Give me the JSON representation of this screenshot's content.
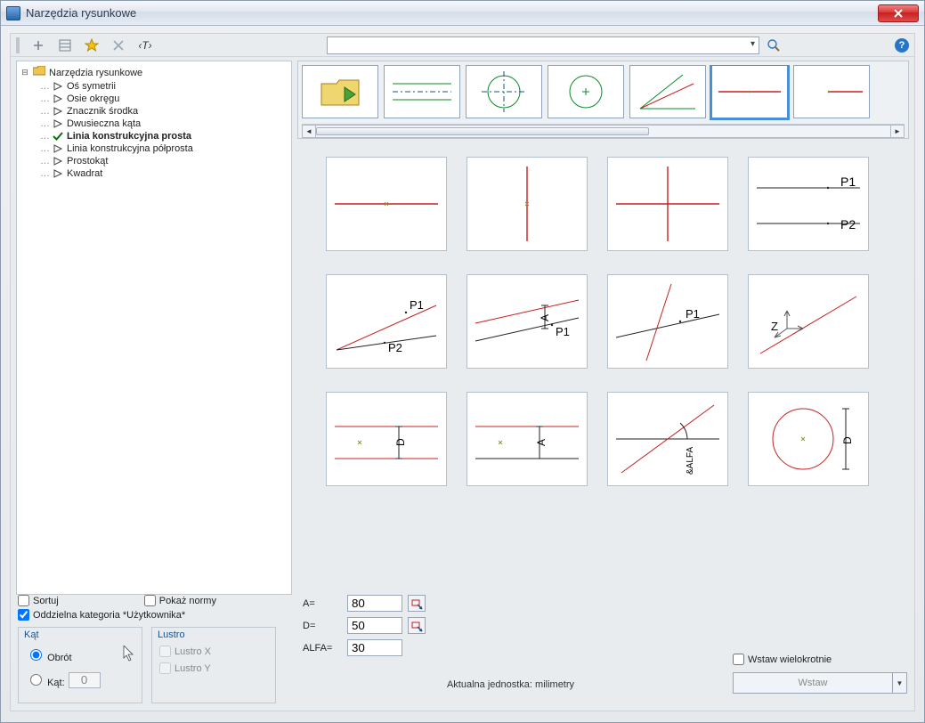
{
  "window": {
    "title": "Narzędzia rysunkowe"
  },
  "toolbar": {
    "tooltip_text": "‹T›",
    "help": "?"
  },
  "tree": {
    "root": "Narzędzia rysunkowe",
    "items": [
      {
        "label": "Oś symetrii",
        "active": false
      },
      {
        "label": "Osie okręgu",
        "active": false
      },
      {
        "label": "Znacznik środka",
        "active": false
      },
      {
        "label": "Dwusieczna kąta",
        "active": false
      },
      {
        "label": "Linia konstrukcyjna prosta",
        "active": true
      },
      {
        "label": "Linia konstrukcyjna półprosta",
        "active": false
      },
      {
        "label": "Prostokąt",
        "active": false
      },
      {
        "label": "Kwadrat",
        "active": false
      }
    ]
  },
  "options": {
    "sort": "Sortuj",
    "show_norms": "Pokaż normy",
    "user_category": "Oddzielna kategoria *Użytkownika*"
  },
  "angle_group": {
    "legend": "Kąt",
    "rotate": "Obrót",
    "angle": "Kąt:",
    "angle_value": "0"
  },
  "mirror_group": {
    "legend": "Lustro",
    "x": "Lustro X",
    "y": "Lustro Y"
  },
  "params": {
    "a_label": "A=",
    "a_value": "80",
    "d_label": "D=",
    "d_value": "50",
    "alfa_label": "ALFA=",
    "alfa_value": "30"
  },
  "units_text": "Aktualna jednostka: milimetry",
  "insert": {
    "multi": "Wstaw wielokrotnie",
    "btn": "Wstaw"
  },
  "labels": {
    "p1": "P1",
    "p2": "P2",
    "z": "Z",
    "d": "D",
    "a": "A",
    "alfa": "&ALFA"
  },
  "thumb_labels": {
    "folder": "up-folder-icon"
  }
}
